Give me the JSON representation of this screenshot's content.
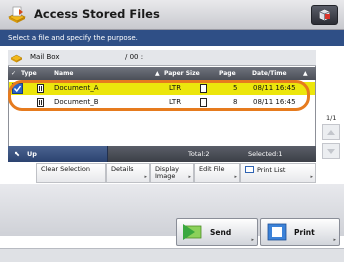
{
  "title": "Access Stored Files",
  "instruction": "Select a file and specify the purpose.",
  "path": {
    "label": "Mail Box",
    "value": "/ 00 :"
  },
  "columns": [
    "Type",
    "Name",
    "Paper Size",
    "Page",
    "Date/Time"
  ],
  "files": [
    {
      "name": "Document_A",
      "paper_size": "LTR",
      "page": "5",
      "datetime": "08/11 16:45",
      "selected": true
    },
    {
      "name": "Document_B",
      "paper_size": "LTR",
      "page": "8",
      "datetime": "08/11 16:45",
      "selected": false
    }
  ],
  "footer": {
    "up": "Up",
    "total": "Total:2",
    "selected": "Selected:1"
  },
  "page_indicator": "1/1",
  "buttons": {
    "clear_selection": "Clear Selection",
    "details": "Details",
    "display_image": "Display Image",
    "edit_file": "Edit File",
    "print_list": "Print List",
    "send": "Send",
    "print": "Print"
  },
  "colors": {
    "selection": "#ece60c",
    "highlight": "#e67b1e",
    "instruction_bar": "#2f4f86"
  }
}
